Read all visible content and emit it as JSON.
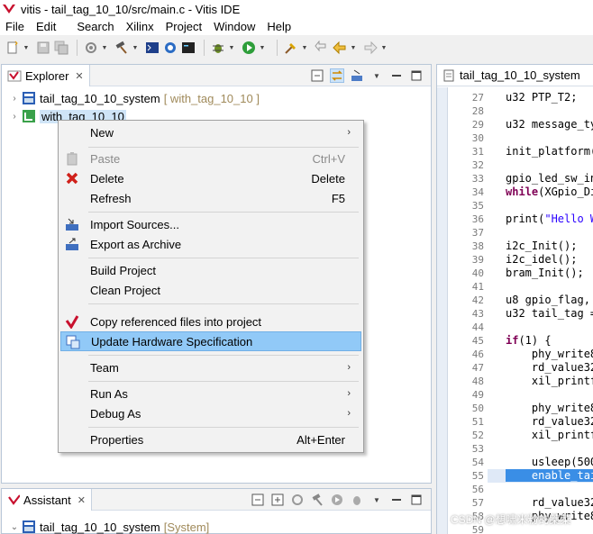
{
  "window": {
    "title": "vitis - tail_tag_10_10/src/main.c - Vitis IDE"
  },
  "menubar": [
    "File",
    "Edit",
    "Search",
    "Xilinx",
    "Project",
    "Window",
    "Help"
  ],
  "explorer": {
    "tab_label": "Explorer",
    "items": [
      {
        "name": "tail_tag_10_10_system",
        "suffix": "[ with_tag_10_10 ]"
      },
      {
        "name": "with_tag_10_10",
        "suffix": ""
      }
    ]
  },
  "context_menu": {
    "items": [
      {
        "label": "New",
        "shortcut": "",
        "submenu": true,
        "disabled": false
      },
      {
        "label": "Paste",
        "shortcut": "Ctrl+V",
        "submenu": false,
        "disabled": true
      },
      {
        "label": "Delete",
        "shortcut": "Delete",
        "submenu": false,
        "disabled": false
      },
      {
        "label": "Refresh",
        "shortcut": "F5",
        "submenu": false,
        "disabled": false
      },
      {
        "label": "Import Sources...",
        "shortcut": "",
        "submenu": false,
        "disabled": false
      },
      {
        "label": "Export as Archive",
        "shortcut": "",
        "submenu": false,
        "disabled": false
      },
      {
        "label": "Build Project",
        "shortcut": "",
        "submenu": false,
        "disabled": false
      },
      {
        "label": "Clean Project",
        "shortcut": "",
        "submenu": false,
        "disabled": false
      },
      {
        "label": "Copy referenced files into project",
        "shortcut": "",
        "submenu": false,
        "disabled": false
      },
      {
        "label": "Update Hardware Specification",
        "shortcut": "",
        "submenu": false,
        "disabled": false,
        "selected": true
      },
      {
        "label": "Team",
        "shortcut": "",
        "submenu": true,
        "disabled": false
      },
      {
        "label": "Run As",
        "shortcut": "",
        "submenu": true,
        "disabled": false
      },
      {
        "label": "Debug As",
        "shortcut": "",
        "submenu": true,
        "disabled": false
      },
      {
        "label": "Properties",
        "shortcut": "Alt+Enter",
        "submenu": false,
        "disabled": false
      }
    ]
  },
  "assistant": {
    "tab_label": "Assistant",
    "items": [
      {
        "name": "tail_tag_10_10_system",
        "suffix": "[System]"
      }
    ]
  },
  "editor": {
    "tab_label": "tail_tag_10_10_system",
    "line_numbers": [
      "27",
      "28",
      "29",
      "30",
      "31",
      "32",
      "33",
      "34",
      "35",
      "36",
      "37",
      "38",
      "39",
      "40",
      "41",
      "42",
      "43",
      "44",
      "45",
      "46",
      "47",
      "48",
      "49",
      "50",
      "51",
      "52",
      "53",
      "54",
      "55",
      "56",
      "57",
      "58",
      "59"
    ],
    "lines": [
      {
        "n": "27",
        "text": "u32 PTP_T2;"
      },
      {
        "n": "29",
        "text": "u32 message_ty"
      },
      {
        "n": "31",
        "text": "init_platform("
      },
      {
        "n": "33",
        "text": "gpio_led_sw_in"
      },
      {
        "n": "34",
        "kw": "while",
        "text": "(XGpio_Di"
      },
      {
        "n": "36",
        "text": "print(",
        "str": "\"Hello W"
      },
      {
        "n": "38",
        "text": "i2c_Init();"
      },
      {
        "n": "39",
        "text": "i2c_idel();"
      },
      {
        "n": "40",
        "text": "bram_Init();"
      },
      {
        "n": "42",
        "text": "u8 gpio_flag,"
      },
      {
        "n": "43",
        "text": "u32 tail_tag ="
      },
      {
        "n": "45",
        "kw": "if",
        "text": "(1) {"
      },
      {
        "n": "46",
        "text": "    phy_write8"
      },
      {
        "n": "47",
        "text": "    rd_value32"
      },
      {
        "n": "48",
        "text": "    xil_printf"
      },
      {
        "n": "50",
        "text": "    phy_write8"
      },
      {
        "n": "51",
        "text": "    rd_value32"
      },
      {
        "n": "52",
        "text": "    xil_printf"
      },
      {
        "n": "54",
        "text": "    usleep(500"
      },
      {
        "n": "55",
        "text": "    enable_tai",
        "highlight": true
      },
      {
        "n": "57",
        "text": "    rd_value32"
      },
      {
        "n": "58",
        "text": "    phy_write8"
      }
    ]
  },
  "watermark": "CSDN @想啸米粉的薬菜",
  "colors": {
    "selection": "#91c9f7",
    "keyword": "#7f0055",
    "string": "#2a00ff",
    "panel_border": "#b9c7d8"
  }
}
